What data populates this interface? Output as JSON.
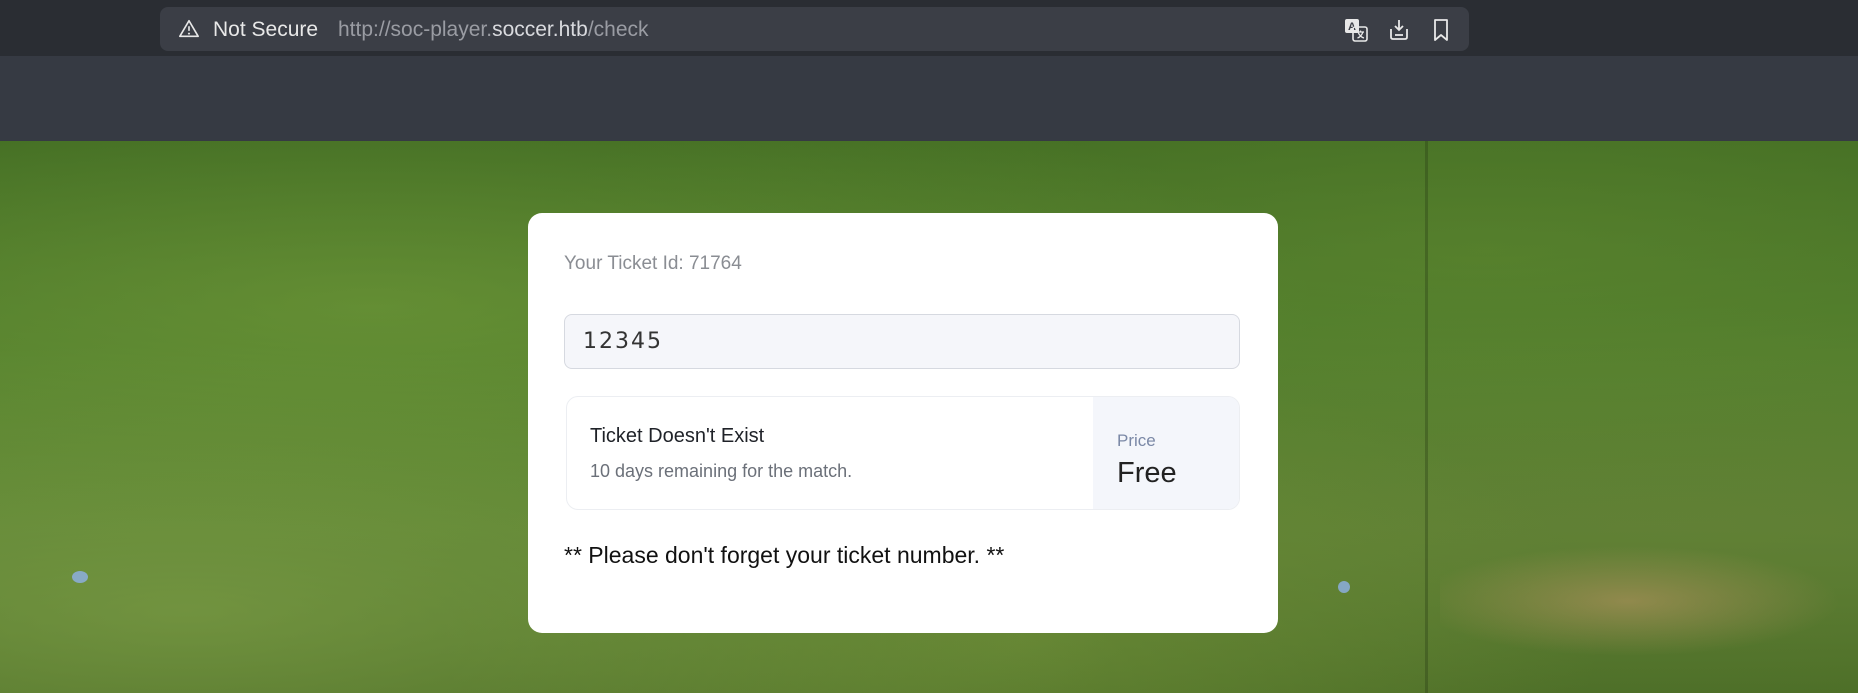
{
  "browser": {
    "security_label": "Not Secure",
    "url_prefix": "http://soc-player.",
    "url_host": "soccer.htb",
    "url_path": "/check",
    "icons": [
      "warning-icon",
      "translate-icon",
      "download-icon",
      "bookmark-icon"
    ]
  },
  "card": {
    "ticket_id_label": "Your Ticket Id: 71764",
    "input_value": "12345",
    "result_title": "Ticket Doesn't Exist",
    "result_subtitle": "10 days remaining for the match.",
    "price_label": "Price",
    "price_value": "Free",
    "note": "** Please don't forget your ticket number. **"
  },
  "colors": {
    "chrome_bg": "#2a2d33",
    "urlbar_bg": "#3b3e46",
    "card_bg": "#ffffff",
    "price_box_bg": "#f4f6fb"
  }
}
